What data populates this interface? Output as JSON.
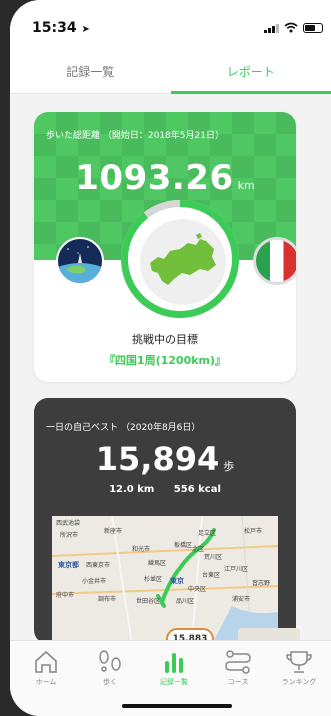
{
  "status": {
    "time": "15:34",
    "location_icon": "location-arrow-icon",
    "wifi_icon": "wifi-icon",
    "battery_icon": "battery-icon"
  },
  "tabs": [
    {
      "label": "記録一覧"
    },
    {
      "label": "レポート"
    }
  ],
  "total_card": {
    "caption": "歩いた総距離 （開始日：2018年5月21日）",
    "distance": "1093.26",
    "unit": "km",
    "goal_label": "挑戦中の目標",
    "goal_name": "『四国1周(1200km)』",
    "progress_percent": 91,
    "colors": {
      "accent": "#3ccb57"
    }
  },
  "best_card": {
    "caption": "一日の自己ベスト （2020年8月6日）",
    "steps": "15,894",
    "steps_unit": "歩",
    "distance": "12.0 km",
    "calories": "556 kcal",
    "map_labels": [
      "西武池袋",
      "所沢市",
      "新座市",
      "板橋区",
      "足立区",
      "松戸市",
      "和光市",
      "北区",
      "荒川区",
      "東京都",
      "西東京市",
      "練馬区",
      "台東区",
      "江戸川区",
      "小金井市",
      "杉並区",
      "東京",
      "中央区",
      "府中市",
      "調布市",
      "世田谷区",
      "品川区",
      "浦安市",
      "習志野"
    ]
  },
  "peek": {
    "badge": "15,883"
  },
  "tabbar": [
    {
      "label": "ホーム",
      "icon": "home-icon"
    },
    {
      "label": "歩く",
      "icon": "footprints-icon"
    },
    {
      "label": "記録一覧",
      "icon": "bar-chart-icon"
    },
    {
      "label": "コース",
      "icon": "route-icon"
    },
    {
      "label": "ランキング",
      "icon": "trophy-icon"
    }
  ]
}
